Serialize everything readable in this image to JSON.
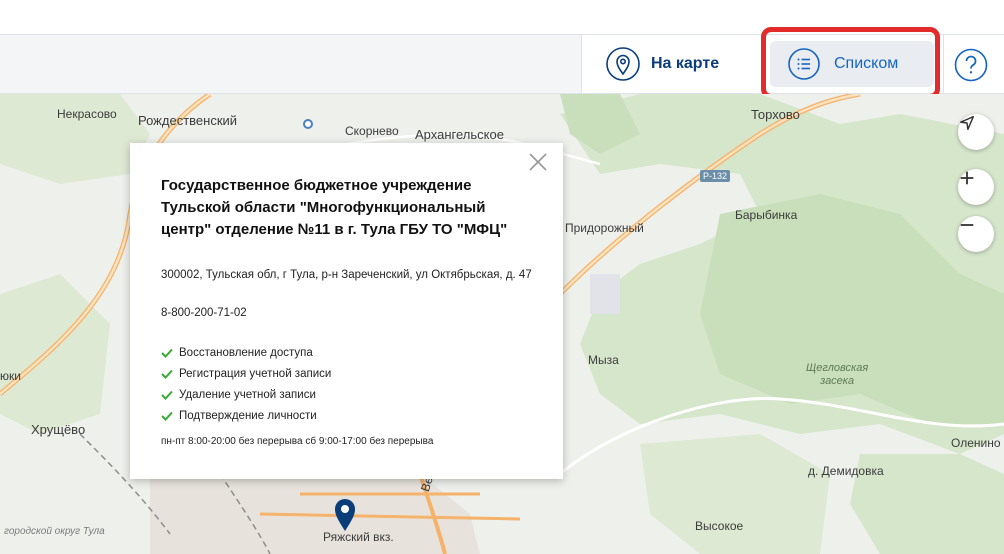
{
  "toolbar": {
    "map_view_label": "На карте",
    "list_view_label": "Списком",
    "help_icon": "question-icon"
  },
  "map": {
    "places": {
      "nekrasovo": "Некрасово",
      "rozhdestvensky": "Рождественский",
      "skornevo": "Скорнево",
      "arkhangelskoe": "Архангельское",
      "torkhovo": "Торхово",
      "barybinka": "Барыбинка",
      "pridorozhny": "Придорожный",
      "myza": "Мыза",
      "shcheglovskaya_1": "Щегловская",
      "shcheglovskaya_2": "засека",
      "olenino": "Оленино",
      "demidovka": "д. Демидовка",
      "vysokoe": "Высокое",
      "khrushchevo": "Хрущёво",
      "yuki": "юки",
      "ryazhsky": "Ряжский вкз.",
      "venevskoe": "Веневск",
      "city_district": "городской округ Тула"
    },
    "road_badge": "Р-132",
    "controls": [
      "navigate-icon",
      "zoom-in-icon",
      "zoom-out-icon"
    ]
  },
  "popup": {
    "name": "Государственное бюджетное учреждение Тульской области \"Многофункциональный центр\" отделение №11 в г. Тула ГБУ ТО \"МФЦ\"",
    "address": "300002, Тульская обл, г Тула, р-н Зареченский, ул Октябрьская, д. 47",
    "phone": "8-800-200-71-02",
    "services": [
      "Восстановление доступа",
      "Регистрация учетной записи",
      "Удаление учетной записи",
      "Подтверждение личности"
    ],
    "hours": "пн-пт 8:00-20:00 без перерыва сб 9:00-17:00 без перерыва"
  },
  "colors": {
    "brand_blue": "#0a3d7a",
    "link_blue": "#1565c0",
    "highlight_red": "#e22b2b",
    "check_green": "#3aa935",
    "forest_green": "#cfe3c2",
    "road_orange": "#f5b26b"
  }
}
